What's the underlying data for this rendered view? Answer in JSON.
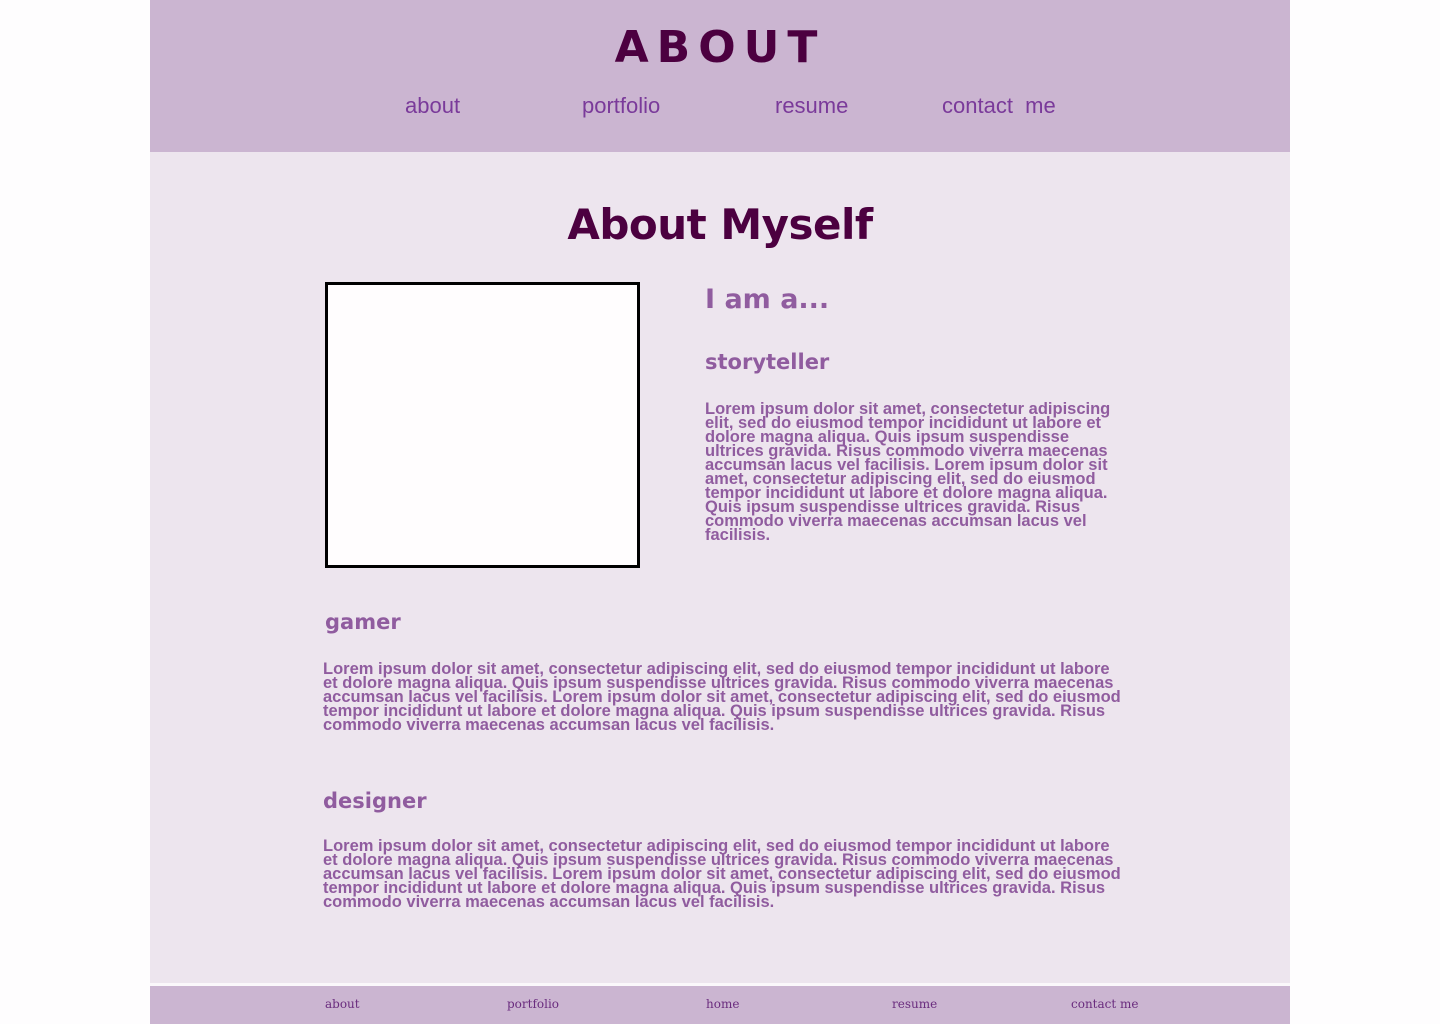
{
  "header": {
    "title": "ABOUT",
    "nav": [
      "about",
      "portfolio",
      "resume",
      "contact  me"
    ]
  },
  "main": {
    "page_title": "About Myself",
    "intro_heading": "I am a...",
    "sections": [
      {
        "heading": "storyteller",
        "text": "Lorem ipsum dolor sit amet, consectetur adipiscing elit, sed do eiusmod tempor incididunt ut labore et dolore magna aliqua. Quis ipsum suspendisse ultrices gravida. Risus commodo viverra maecenas accumsan lacus vel facilisis. Lorem ipsum dolor sit amet, consectetur adipiscing elit, sed do eiusmod tempor incididunt ut labore et dolore magna aliqua. Quis ipsum suspendisse ultrices gravida. Risus commodo viverra maecenas accumsan lacus vel facilisis."
      },
      {
        "heading": "gamer",
        "text": "Lorem ipsum dolor sit amet, consectetur adipiscing elit, sed do eiusmod tempor incididunt ut labore et dolore magna aliqua. Quis ipsum suspendisse ultrices gravida. Risus commodo viverra maecenas accumsan lacus vel facilisis. Lorem ipsum dolor sit amet, consectetur adipiscing elit, sed do eiusmod tempor incididunt ut labore et dolore magna aliqua. Quis ipsum suspendisse ultrices gravida. Risus commodo viverra maecenas accumsan lacus vel facilisis."
      },
      {
        "heading": "designer",
        "text": "Lorem ipsum dolor sit amet, consectetur adipiscing elit, sed do eiusmod tempor incididunt ut labore et dolore magna aliqua. Quis ipsum suspendisse ultrices gravida. Risus commodo viverra maecenas accumsan lacus vel facilisis. Lorem ipsum dolor sit amet, consectetur adipiscing elit, sed do eiusmod tempor incididunt ut labore et dolore magna aliqua. Quis ipsum suspendisse ultrices gravida. Risus commodo viverra maecenas accumsan lacus vel facilisis."
      }
    ]
  },
  "footer": {
    "nav": [
      "about",
      "portfolio",
      "home",
      "resume",
      "contact me"
    ]
  },
  "colors": {
    "header_bg": "#cbb5d1",
    "content_bg": "#ede5ee",
    "title": "#4c0040",
    "nav_link": "#7a3a9a",
    "body_text": "#905c9f"
  }
}
